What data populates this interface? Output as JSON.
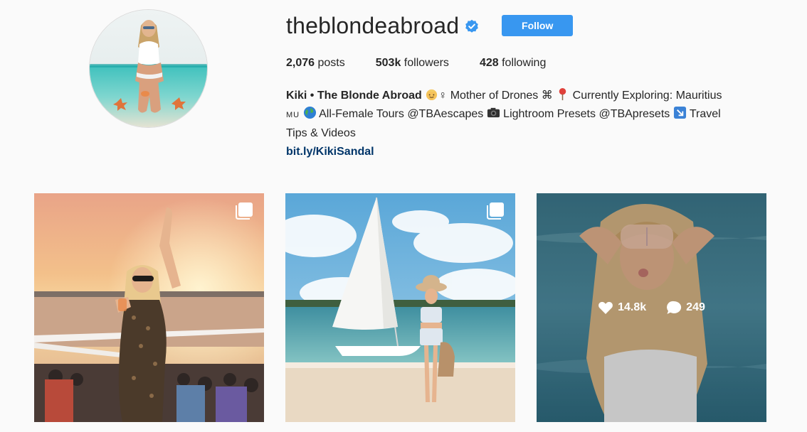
{
  "profile": {
    "username": "theblondeabroad",
    "follow_label": "Follow",
    "stats": {
      "posts_count": "2,076",
      "posts_label": "posts",
      "followers_count": "503k",
      "followers_label": "followers",
      "following_count": "428",
      "following_label": "following"
    },
    "bio": {
      "name": "Kiki • The Blonde Abroad",
      "line1_rest": "♀ Mother of Drones ⌘ ",
      "line1_end": " Currently Exploring: Mauritius",
      "line2_code": "MU",
      "line2_a": " All-Female Tours @TBAescapes ",
      "line2_b": " Lightroom Presets @TBApresets ",
      "line2_c": " Travel",
      "line3": "Tips & Videos",
      "link": "bit.ly/KikiSandal"
    }
  },
  "posts": [
    {
      "type": "carousel"
    },
    {
      "type": "carousel"
    },
    {
      "type": "photo",
      "likes": "14.8k",
      "comments": "249"
    }
  ],
  "colors": {
    "accent": "#3897f0",
    "verified": "#3897f0",
    "link": "#003569",
    "text": "#262626",
    "background": "#fafafa"
  },
  "icons": [
    "verified-badge-icon",
    "multiple-photos-icon",
    "heart-icon",
    "comment-icon",
    "person-emoji-icon",
    "pin-emoji-icon",
    "globe-emoji-icon",
    "camera-emoji-icon",
    "arrow-emoji-icon"
  ]
}
